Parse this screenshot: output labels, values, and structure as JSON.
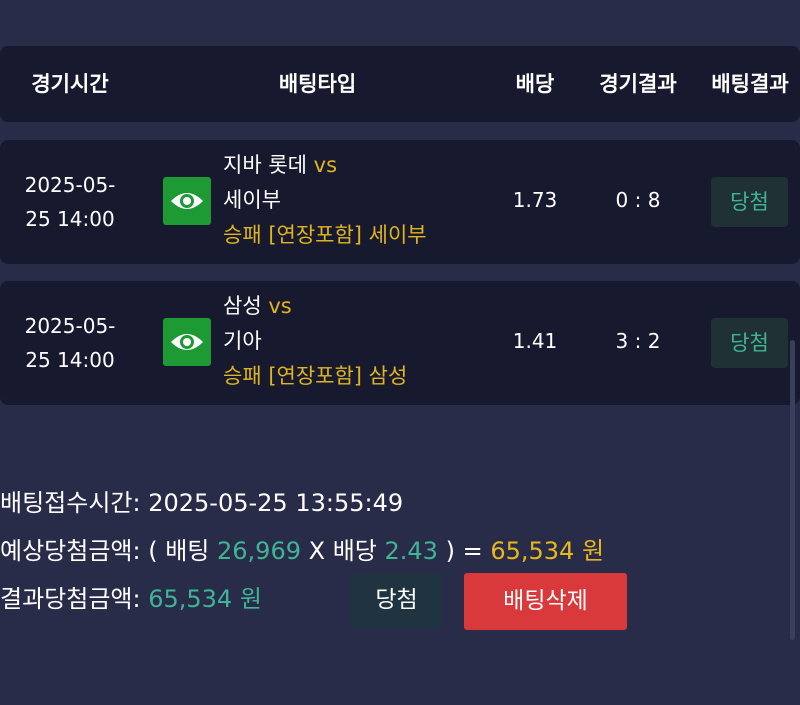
{
  "header": {
    "col_time": "경기시간",
    "col_type": "배팅타입",
    "col_odds": "배당",
    "col_game_result": "경기결과",
    "col_bet_result": "배팅결과"
  },
  "bets": [
    {
      "date": "2025-05-",
      "time": "25 14:00",
      "home": "지바 롯데",
      "vs": "vs",
      "away": "세이부",
      "bet_type": "승패 [연장포함] 세이부",
      "odds": "1.73",
      "score": "0 : 8",
      "result": "당첨"
    },
    {
      "date": "2025-05-",
      "time": "25 14:00",
      "home": "삼성",
      "vs": "vs",
      "away": "기아",
      "bet_type": "승패 [연장포함] 삼성",
      "odds": "1.41",
      "score": "3 : 2",
      "result": "당첨"
    }
  ],
  "summary": {
    "received_label": "배팅접수시간:",
    "received_value": "2025-05-25 13:55:49",
    "expected_label": "예상당첨금액:",
    "expected_open": "( 배팅",
    "stake": "26,969",
    "times_odds": "X 배당",
    "total_odds": "2.43",
    "close_eq": ") =",
    "expected_amount": "65,534 원",
    "actual_label": "결과당첨금액:",
    "actual_amount": "65,534 원"
  },
  "buttons": {
    "win_label": "당첨",
    "delete_label": "배팅삭제"
  },
  "icons": {
    "view": "eye-icon"
  },
  "colors": {
    "background": "#282c48",
    "row_bg": "#171a2e",
    "accent_gold": "#e0b321",
    "accent_green": "#3fb595",
    "eye_button": "#1d9a33",
    "delete_button": "#d9393a"
  }
}
